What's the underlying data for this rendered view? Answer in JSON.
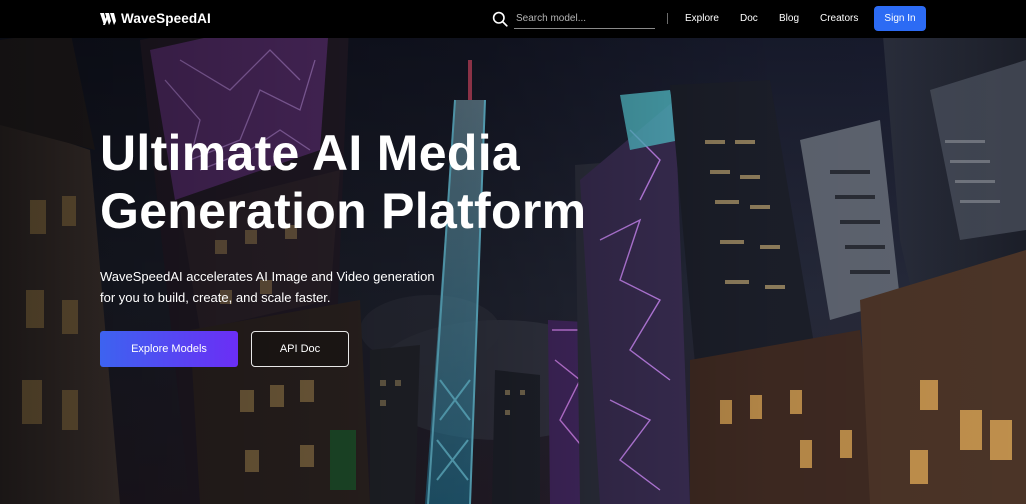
{
  "header": {
    "logo_text": "WaveSpeedAI",
    "search_placeholder": "Search model...",
    "nav": {
      "explore": "Explore",
      "doc": "Doc",
      "blog": "Blog",
      "creators": "Creators"
    },
    "signin_label": "Sign In"
  },
  "hero": {
    "title_line1": "Ultimate AI Media",
    "title_line2": "Generation Platform",
    "subtitle_line1": "WaveSpeedAI accelerates AI Image and Video generation",
    "subtitle_line2": "for you to build, create, and scale faster.",
    "primary_button": "Explore Models",
    "secondary_button": "API Doc"
  },
  "colors": {
    "header_bg": "#000000",
    "signin_bg": "#2c6bf4",
    "primary_gradient_start": "#3d63f0",
    "primary_gradient_end": "#6b2ef5",
    "neon_purple": "#c77dff",
    "neon_cyan": "#4fd6ff"
  },
  "icons": {
    "logo": "wavespeed-logo-icon",
    "search": "search-icon"
  }
}
